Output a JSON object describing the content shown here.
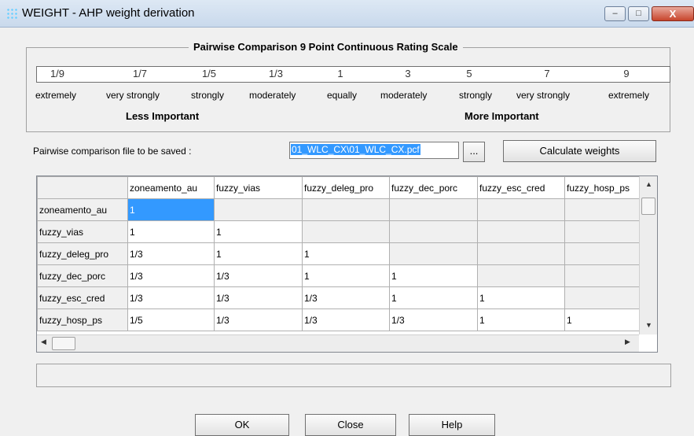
{
  "window": {
    "title": "WEIGHT - AHP weight derivation",
    "min": "–",
    "max": "□",
    "close": "X"
  },
  "scale": {
    "title": "Pairwise Comparison 9 Point Continuous Rating Scale",
    "values": [
      "1/9",
      "1/7",
      "1/5",
      "1/3",
      "1",
      "3",
      "5",
      "7",
      "9"
    ],
    "words": [
      "extremely",
      "very strongly",
      "strongly",
      "moderately",
      "equally",
      "moderately",
      "strongly",
      "very strongly",
      "extremely"
    ],
    "less_important": "Less Important",
    "more_important": "More Important"
  },
  "file": {
    "label": "Pairwise comparison file to be saved :",
    "value": "01_WLC_CX\\01_WLC_CX.pcf",
    "browse": "...",
    "calculate": "Calculate weights"
  },
  "grid": {
    "columns": [
      "zoneamento_au",
      "fuzzy_vias",
      "fuzzy_deleg_pro",
      "fuzzy_dec_porc",
      "fuzzy_esc_cred",
      "fuzzy_hosp_ps"
    ],
    "rows": [
      {
        "label": "zoneamento_au",
        "values": [
          "1",
          "",
          "",
          "",
          "",
          ""
        ]
      },
      {
        "label": "fuzzy_vias",
        "values": [
          "1",
          "1",
          "",
          "",
          "",
          ""
        ]
      },
      {
        "label": "fuzzy_deleg_pro",
        "values": [
          "1/3",
          "1",
          "1",
          "",
          "",
          ""
        ]
      },
      {
        "label": "fuzzy_dec_porc",
        "values": [
          "1/3",
          "1/3",
          "1",
          "1",
          "",
          ""
        ]
      },
      {
        "label": "fuzzy_esc_cred",
        "values": [
          "1/3",
          "1/3",
          "1/3",
          "1",
          "1",
          ""
        ]
      },
      {
        "label": "fuzzy_hosp_ps",
        "values": [
          "1/5",
          "1/3",
          "1/3",
          "1/3",
          "1",
          "1"
        ]
      }
    ],
    "arrow_up": "▲",
    "arrow_down": "▼",
    "arrow_left": "◀",
    "arrow_right": "▶"
  },
  "buttons": {
    "ok": "OK",
    "close": "Close",
    "help": "Help"
  }
}
